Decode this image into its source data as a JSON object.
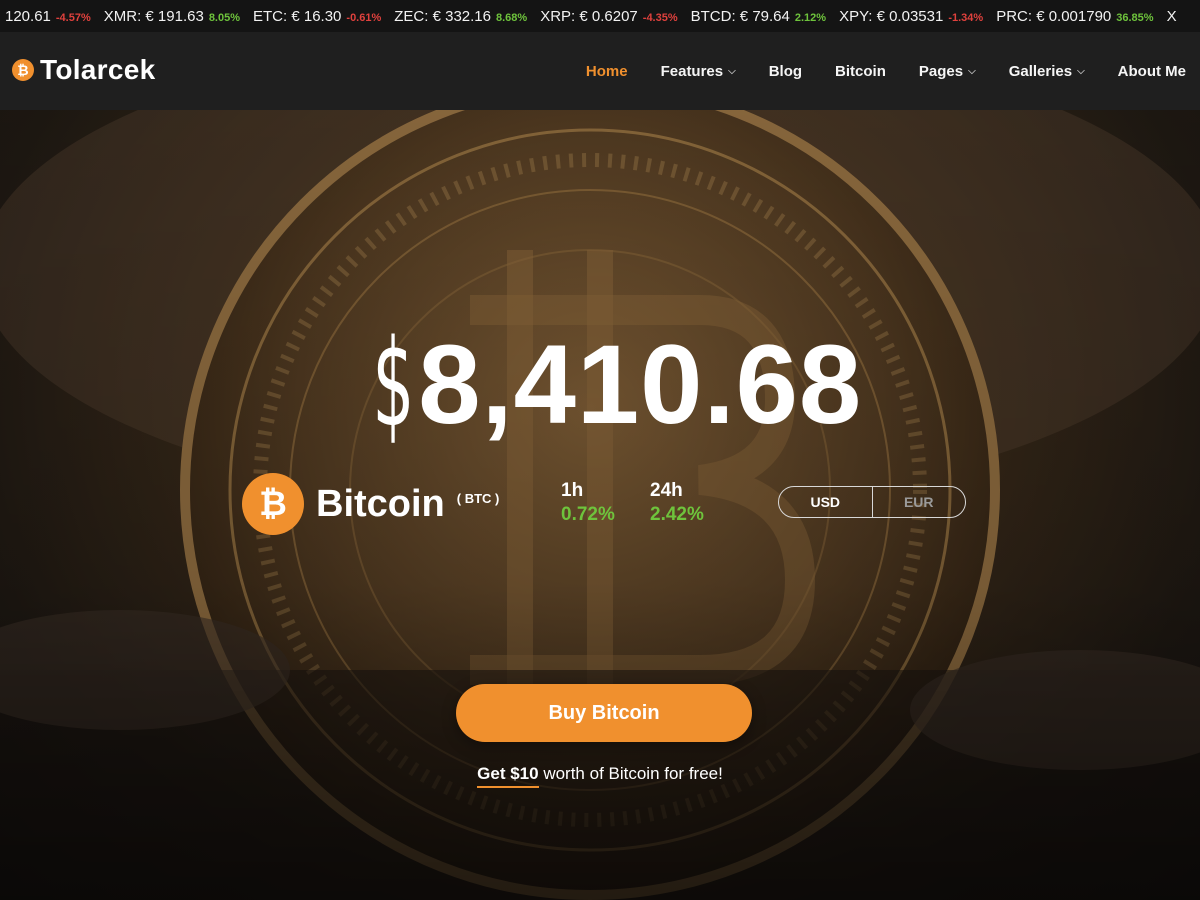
{
  "ticker": [
    {
      "symbol": "120.61",
      "change": "-4.57%",
      "dir": "neg"
    },
    {
      "symbol": "XMR: € 191.63",
      "change": "8.05%",
      "dir": "pos"
    },
    {
      "symbol": "ETC: € 16.30",
      "change": "-0.61%",
      "dir": "neg"
    },
    {
      "symbol": "ZEC: € 332.16",
      "change": "8.68%",
      "dir": "pos"
    },
    {
      "symbol": "XRP: € 0.6207",
      "change": "-4.35%",
      "dir": "neg"
    },
    {
      "symbol": "BTCD: € 79.64",
      "change": "2.12%",
      "dir": "pos"
    },
    {
      "symbol": "XPY: € 0.03531",
      "change": "-1.34%",
      "dir": "neg"
    },
    {
      "symbol": "PRC: € 0.001790",
      "change": "36.85%",
      "dir": "pos"
    },
    {
      "symbol": "X",
      "change": "",
      "dir": "pos"
    }
  ],
  "brand": {
    "name": "Tolarcek",
    "icon": "bitcoin-icon",
    "coin_glyph": "₿"
  },
  "nav": {
    "home": "Home",
    "features": "Features",
    "blog": "Blog",
    "bitcoin": "Bitcoin",
    "pages": "Pages",
    "galleries": "Galleries",
    "about": "About Me",
    "dropdown_icon": "chevron-down-icon"
  },
  "hero": {
    "currency_symbol": "$",
    "price": "8,410.68",
    "coin_name": "Bitcoin",
    "coin_symbol": "( BTC )",
    "coin_glyph": "₿",
    "change_1h_label": "1h",
    "change_1h_value": "0.72%",
    "change_24h_label": "24h",
    "change_24h_value": "2.42%",
    "currency_options": [
      "USD",
      "EUR"
    ],
    "selected_currency": "USD",
    "buy_button": "Buy Bitcoin",
    "promo_link": "Get $10",
    "promo_rest": " worth of Bitcoin for free!"
  },
  "colors": {
    "accent": "#f0902e",
    "positive": "#6ec33c",
    "negative": "#e0413d",
    "navbar_bg": "#1f1f1f",
    "ticker_bg": "#141414"
  }
}
